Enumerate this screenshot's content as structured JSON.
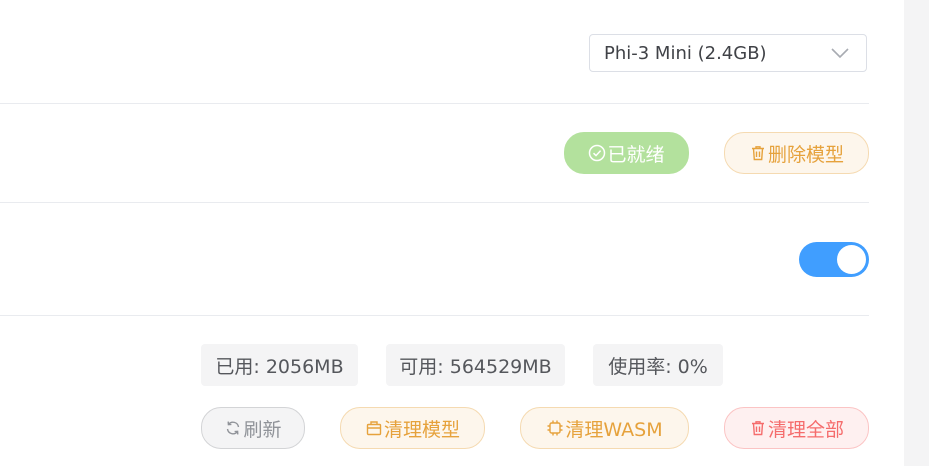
{
  "model": {
    "selected": "Phi-3 Mini (2.4GB)",
    "status_label": "已就绪",
    "delete_label": "删除模型"
  },
  "toggle": {
    "on": true
  },
  "memory": {
    "used": "已用: 2056MB",
    "available": "可用: 564529MB",
    "usage_rate": "使用率: 0%"
  },
  "actions": {
    "refresh_label": "刷新",
    "clean_model_label": "清理模型",
    "clean_wasm_label": "清理WASM",
    "clean_all_label": "清理全部"
  },
  "colors": {
    "primary": "#409eff",
    "success_light": "#b3e19d",
    "warning": "#e6a23c",
    "danger": "#f56c6c",
    "info": "#909399"
  },
  "icons": {
    "status": "circle-check-icon",
    "delete": "trash-icon",
    "refresh": "refresh-icon",
    "clean_model": "box-icon",
    "clean_wasm": "chip-icon",
    "clean_all": "trash-icon",
    "select": "chevron-down-icon"
  }
}
